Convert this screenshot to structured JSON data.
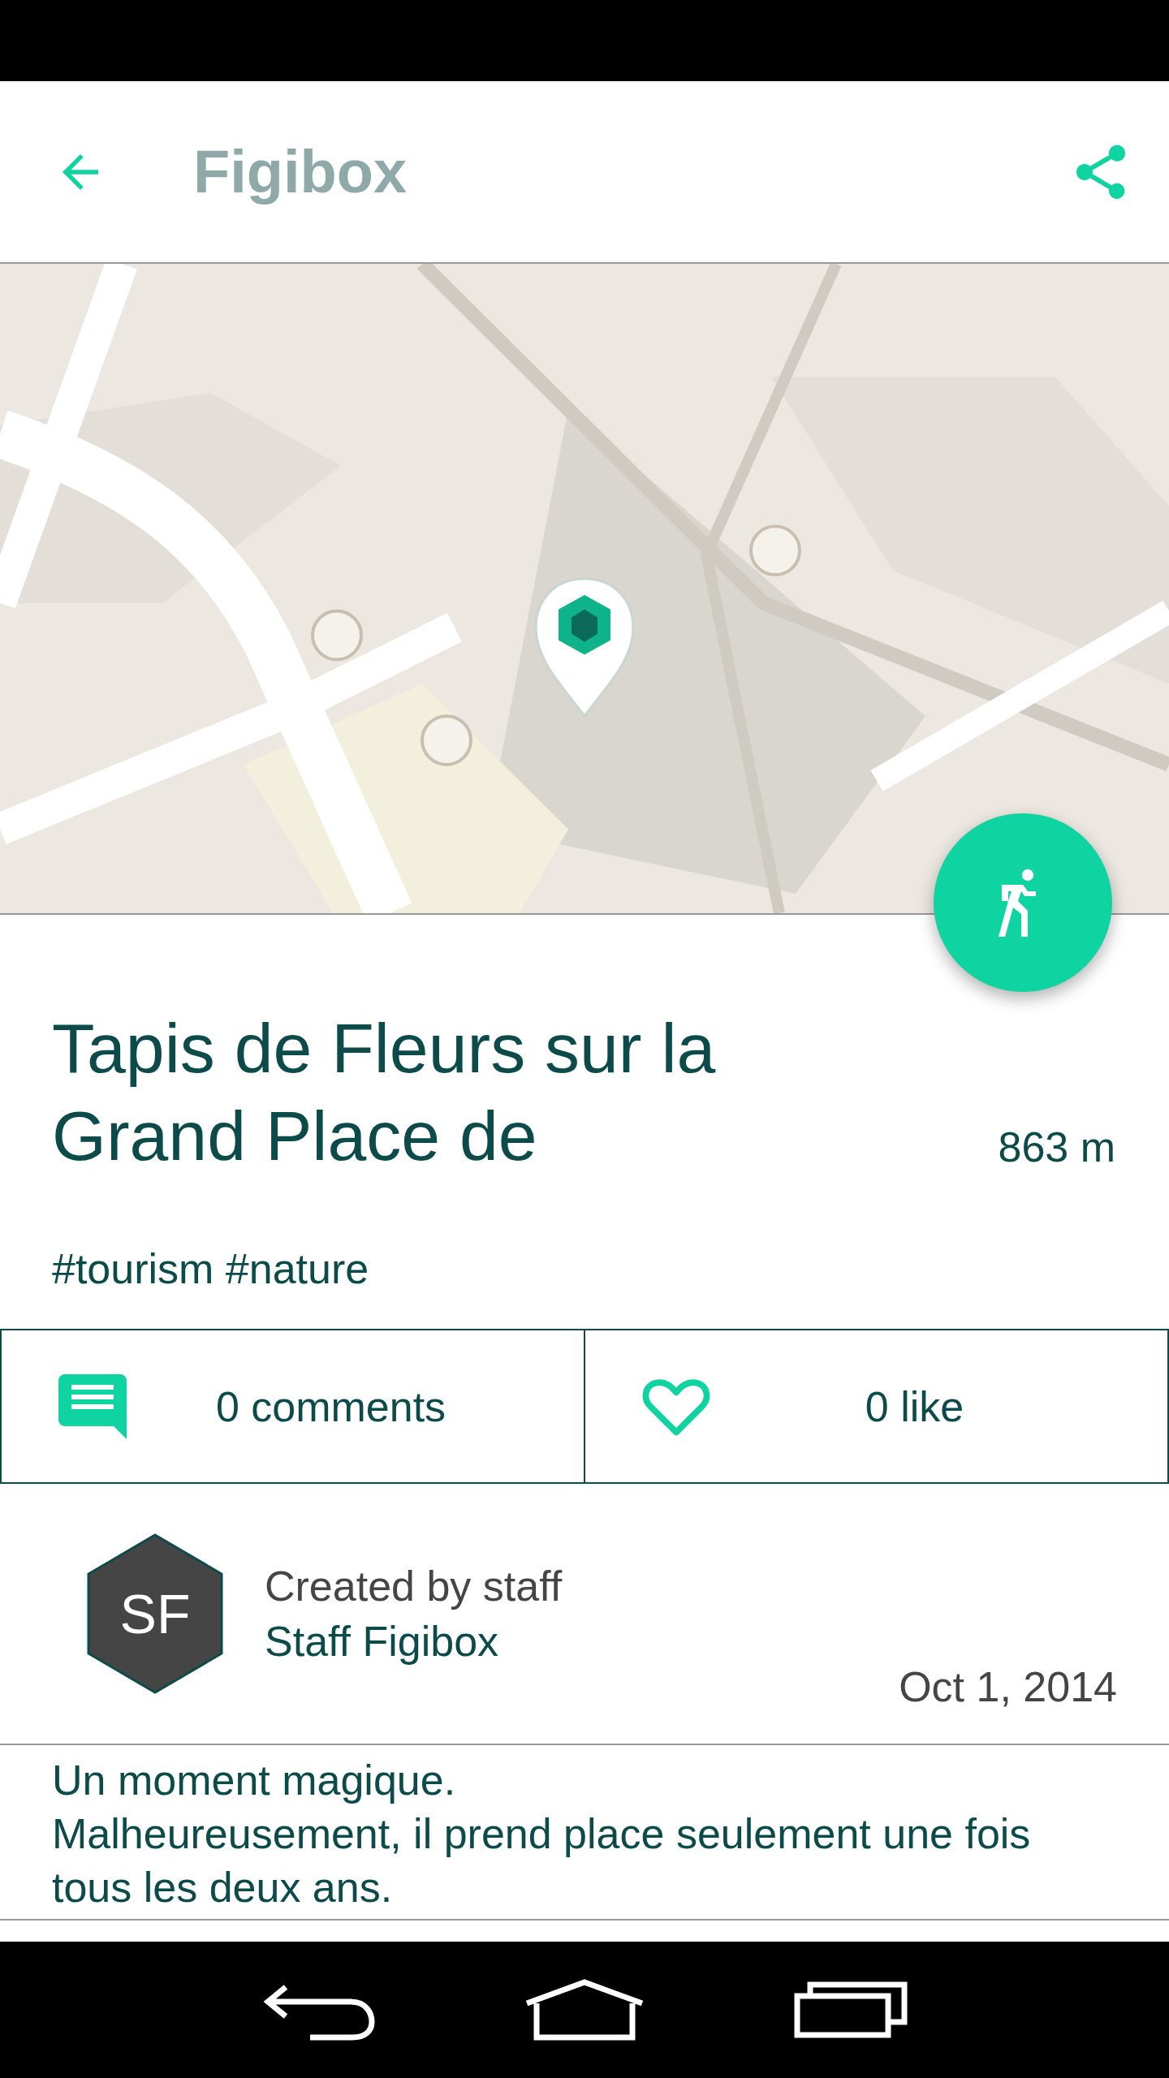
{
  "app_bar": {
    "title": "Figibox"
  },
  "event": {
    "title": "Tapis de Fleurs sur la Grand Place de",
    "distance": "863 m",
    "tags": "#tourism #nature"
  },
  "stats": [
    {
      "kind": "comments",
      "label": "0 comments"
    },
    {
      "kind": "likes",
      "label": "0 like",
      "liked": false
    }
  ],
  "author": {
    "initials": "SF",
    "caption": "Created by staff",
    "name": "Staff Figibox",
    "date": "Oct 1, 2014"
  },
  "description": "Un moment magique.\nMalheureusement, il prend place seulement une fois tous les deux ans."
}
